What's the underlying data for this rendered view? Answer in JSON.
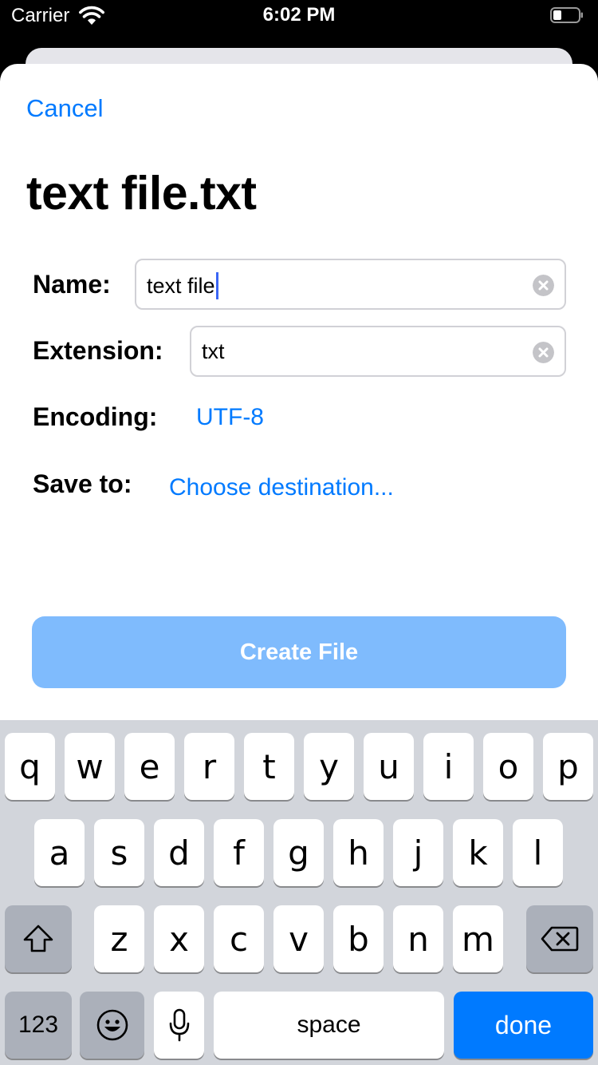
{
  "status_bar": {
    "carrier": "Carrier",
    "time": "6:02 PM"
  },
  "header": {
    "cancel_label": "Cancel",
    "title": "text file.txt"
  },
  "form": {
    "name_label": "Name:",
    "name_value": "text file",
    "extension_label": "Extension:",
    "extension_value": "txt",
    "encoding_label": "Encoding:",
    "encoding_value": "UTF-8",
    "save_to_label": "Save to:",
    "save_to_value": "Choose destination..."
  },
  "create_button_label": "Create File",
  "keyboard": {
    "row1": [
      "q",
      "w",
      "e",
      "r",
      "t",
      "y",
      "u",
      "i",
      "o",
      "p"
    ],
    "row2": [
      "a",
      "s",
      "d",
      "f",
      "g",
      "h",
      "j",
      "k",
      "l"
    ],
    "row3": [
      "z",
      "x",
      "c",
      "v",
      "b",
      "n",
      "m"
    ],
    "numbers_key": "123",
    "space_key": "space",
    "done_key": "done"
  },
  "colors": {
    "accent": "#007aff",
    "create_button_disabled": "#7fbbfd",
    "keyboard_bg": "#d2d5db"
  }
}
